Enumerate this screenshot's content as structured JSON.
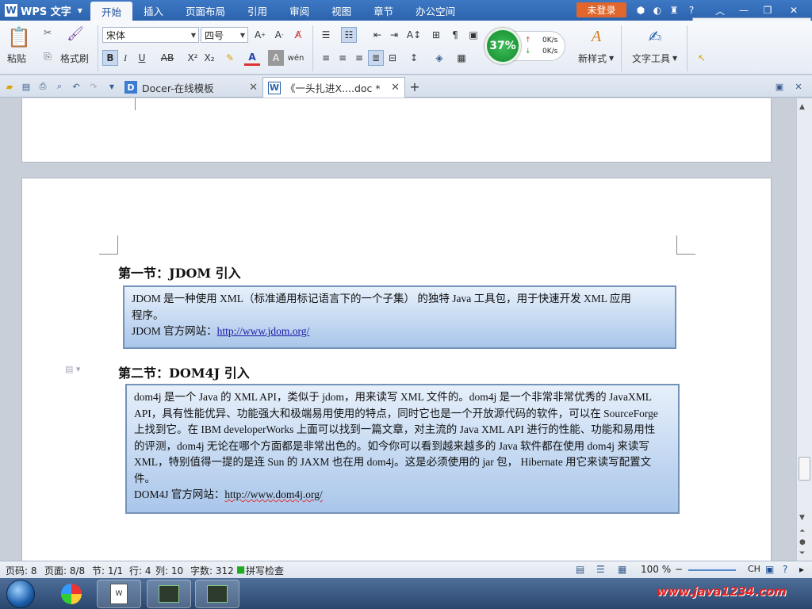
{
  "app": {
    "name": "WPS 文字",
    "login_label": "未登录"
  },
  "menu": [
    "开始",
    "插入",
    "页面布局",
    "引用",
    "审阅",
    "视图",
    "章节",
    "办公空间"
  ],
  "ribbon": {
    "paste_label": "粘贴",
    "format_painter_label": "格式刷",
    "font_name": "宋体",
    "font_size": "四号",
    "new_style_label": "新样式",
    "text_tools_label": "文字工具"
  },
  "speed_widget": {
    "percent": "37%",
    "upload": "0K/s",
    "download": "0K/s"
  },
  "ime": [
    "中"
  ],
  "tabs": [
    {
      "label": "Docer-在线模板",
      "active": false
    },
    {
      "label": "《一头扎进X....doc *",
      "active": true
    }
  ],
  "document": {
    "section1": {
      "title": "第一节：JDOM 引入",
      "line1": "JDOM 是一种使用 XML（标准通用标记语言下的一个子集） 的独特 Java 工具包，用于快速开发 XML 应用",
      "line2": "程序。",
      "site_label": "JDOM 官方网站：",
      "site_url": "http://www.jdom.org/"
    },
    "section2": {
      "title": "第二节：DOM4J 引入",
      "lines": [
        "dom4j 是一个 Java 的 XML API，类似于 jdom，用来读写 XML 文件的。dom4j 是一个非常非常优秀的 JavaXML",
        "API，具有性能优异、功能强大和极端易用使用的特点，同时它也是一个开放源代码的软件，可以在 SourceForge",
        "上找到它。在 IBM developerWorks 上面可以找到一篇文章，对主流的 Java XML API 进行的性能、功能和易用性",
        "的评测，dom4j 无论在哪个方面都是非常出色的。如今你可以看到越来越多的 Java 软件都在使用 dom4j 来读写",
        "XML，特别值得一提的是连 Sun 的 JAXM 也在用 dom4j。这是必须使用的 jar 包， Hibernate 用它来读写配置文",
        "件。"
      ],
      "site_label": "DOM4J 官方网站：",
      "site_url": "http://www.dom4j.org/"
    }
  },
  "status": {
    "page_num": "页码: 8",
    "pages": "页面: 8/8",
    "section": "节: 1/1",
    "row": "行: 4",
    "col": "列: 10",
    "word_count": "字数: 312",
    "spell_check": "拼写检查",
    "zoom": "100 %",
    "lang": "CH"
  },
  "watermark": "www.java1234.com",
  "colors": {
    "titlebar": "#2c63ad",
    "login": "#e0662c",
    "box_border": "#7592b8"
  }
}
